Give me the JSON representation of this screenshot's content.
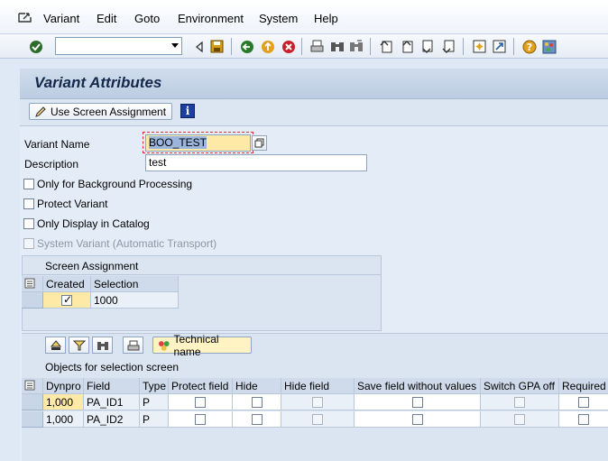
{
  "menu": {
    "items": [
      "Variant",
      "Edit",
      "Goto",
      "Environment",
      "System",
      "Help"
    ]
  },
  "header": {
    "title": "Variant Attributes"
  },
  "app_toolbar": {
    "use_screen_assignment": "Use Screen Assignment"
  },
  "form": {
    "variant_name_label": "Variant Name",
    "variant_name_value": "BOO_TEST",
    "description_label": "Description",
    "description_value": "test",
    "checkboxes": [
      {
        "label": "Only for Background Processing",
        "checked": false,
        "enabled": true
      },
      {
        "label": "Protect Variant",
        "checked": false,
        "enabled": true
      },
      {
        "label": "Only Display in Catalog",
        "checked": false,
        "enabled": true
      },
      {
        "label": "System Variant (Automatic Transport)",
        "checked": false,
        "enabled": false
      }
    ]
  },
  "screen_assignment": {
    "title": "Screen Assignment",
    "columns": [
      "Created",
      "Selection Screen"
    ],
    "rows": [
      {
        "created": true,
        "selection_screen": "1000"
      }
    ]
  },
  "objects": {
    "technical_name_button": "Technical name",
    "title": "Objects for selection screen",
    "columns": [
      "Dynpro",
      "Field name",
      "Type",
      "Protect field",
      "Hide field",
      "Hide field 'TO'",
      "Save field without values",
      "Switch GPA off",
      "Required"
    ],
    "rows": [
      {
        "dynpro": "1,000",
        "field_name": "PA_ID1",
        "type": "P"
      },
      {
        "dynpro": "1,000",
        "field_name": "PA_ID2",
        "type": "P"
      }
    ]
  },
  "colors": {
    "title_text": "#14284b",
    "accent_yellow": "#ffe9a6",
    "background": "#dfe9f5"
  }
}
